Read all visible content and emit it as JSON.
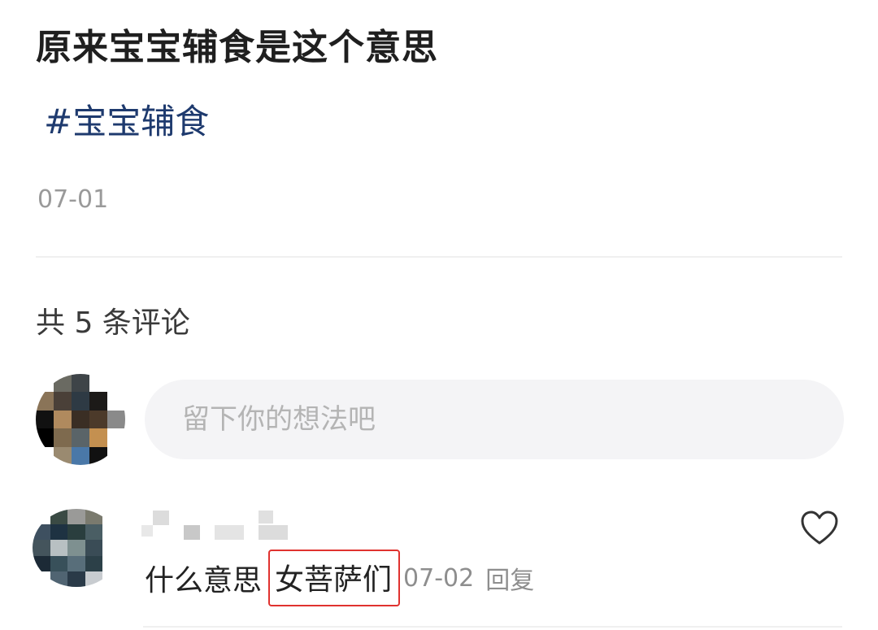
{
  "post": {
    "title": "原来宝宝辅食是这个意思",
    "topic": "#宝宝辅食",
    "date": "07-01"
  },
  "comments_section": {
    "count_label": "共 5 条评论",
    "input_placeholder": "留下你的想法吧"
  },
  "comments": [
    {
      "text": "什么意思",
      "highlighted_text": "女菩萨们",
      "date": "07-02",
      "reply_label": "回复",
      "like_icon": "heart-outline-icon"
    }
  ],
  "colors": {
    "topic": "#1e3a6e",
    "highlight_border": "#e0322f",
    "input_background": "#f4f4f6"
  }
}
